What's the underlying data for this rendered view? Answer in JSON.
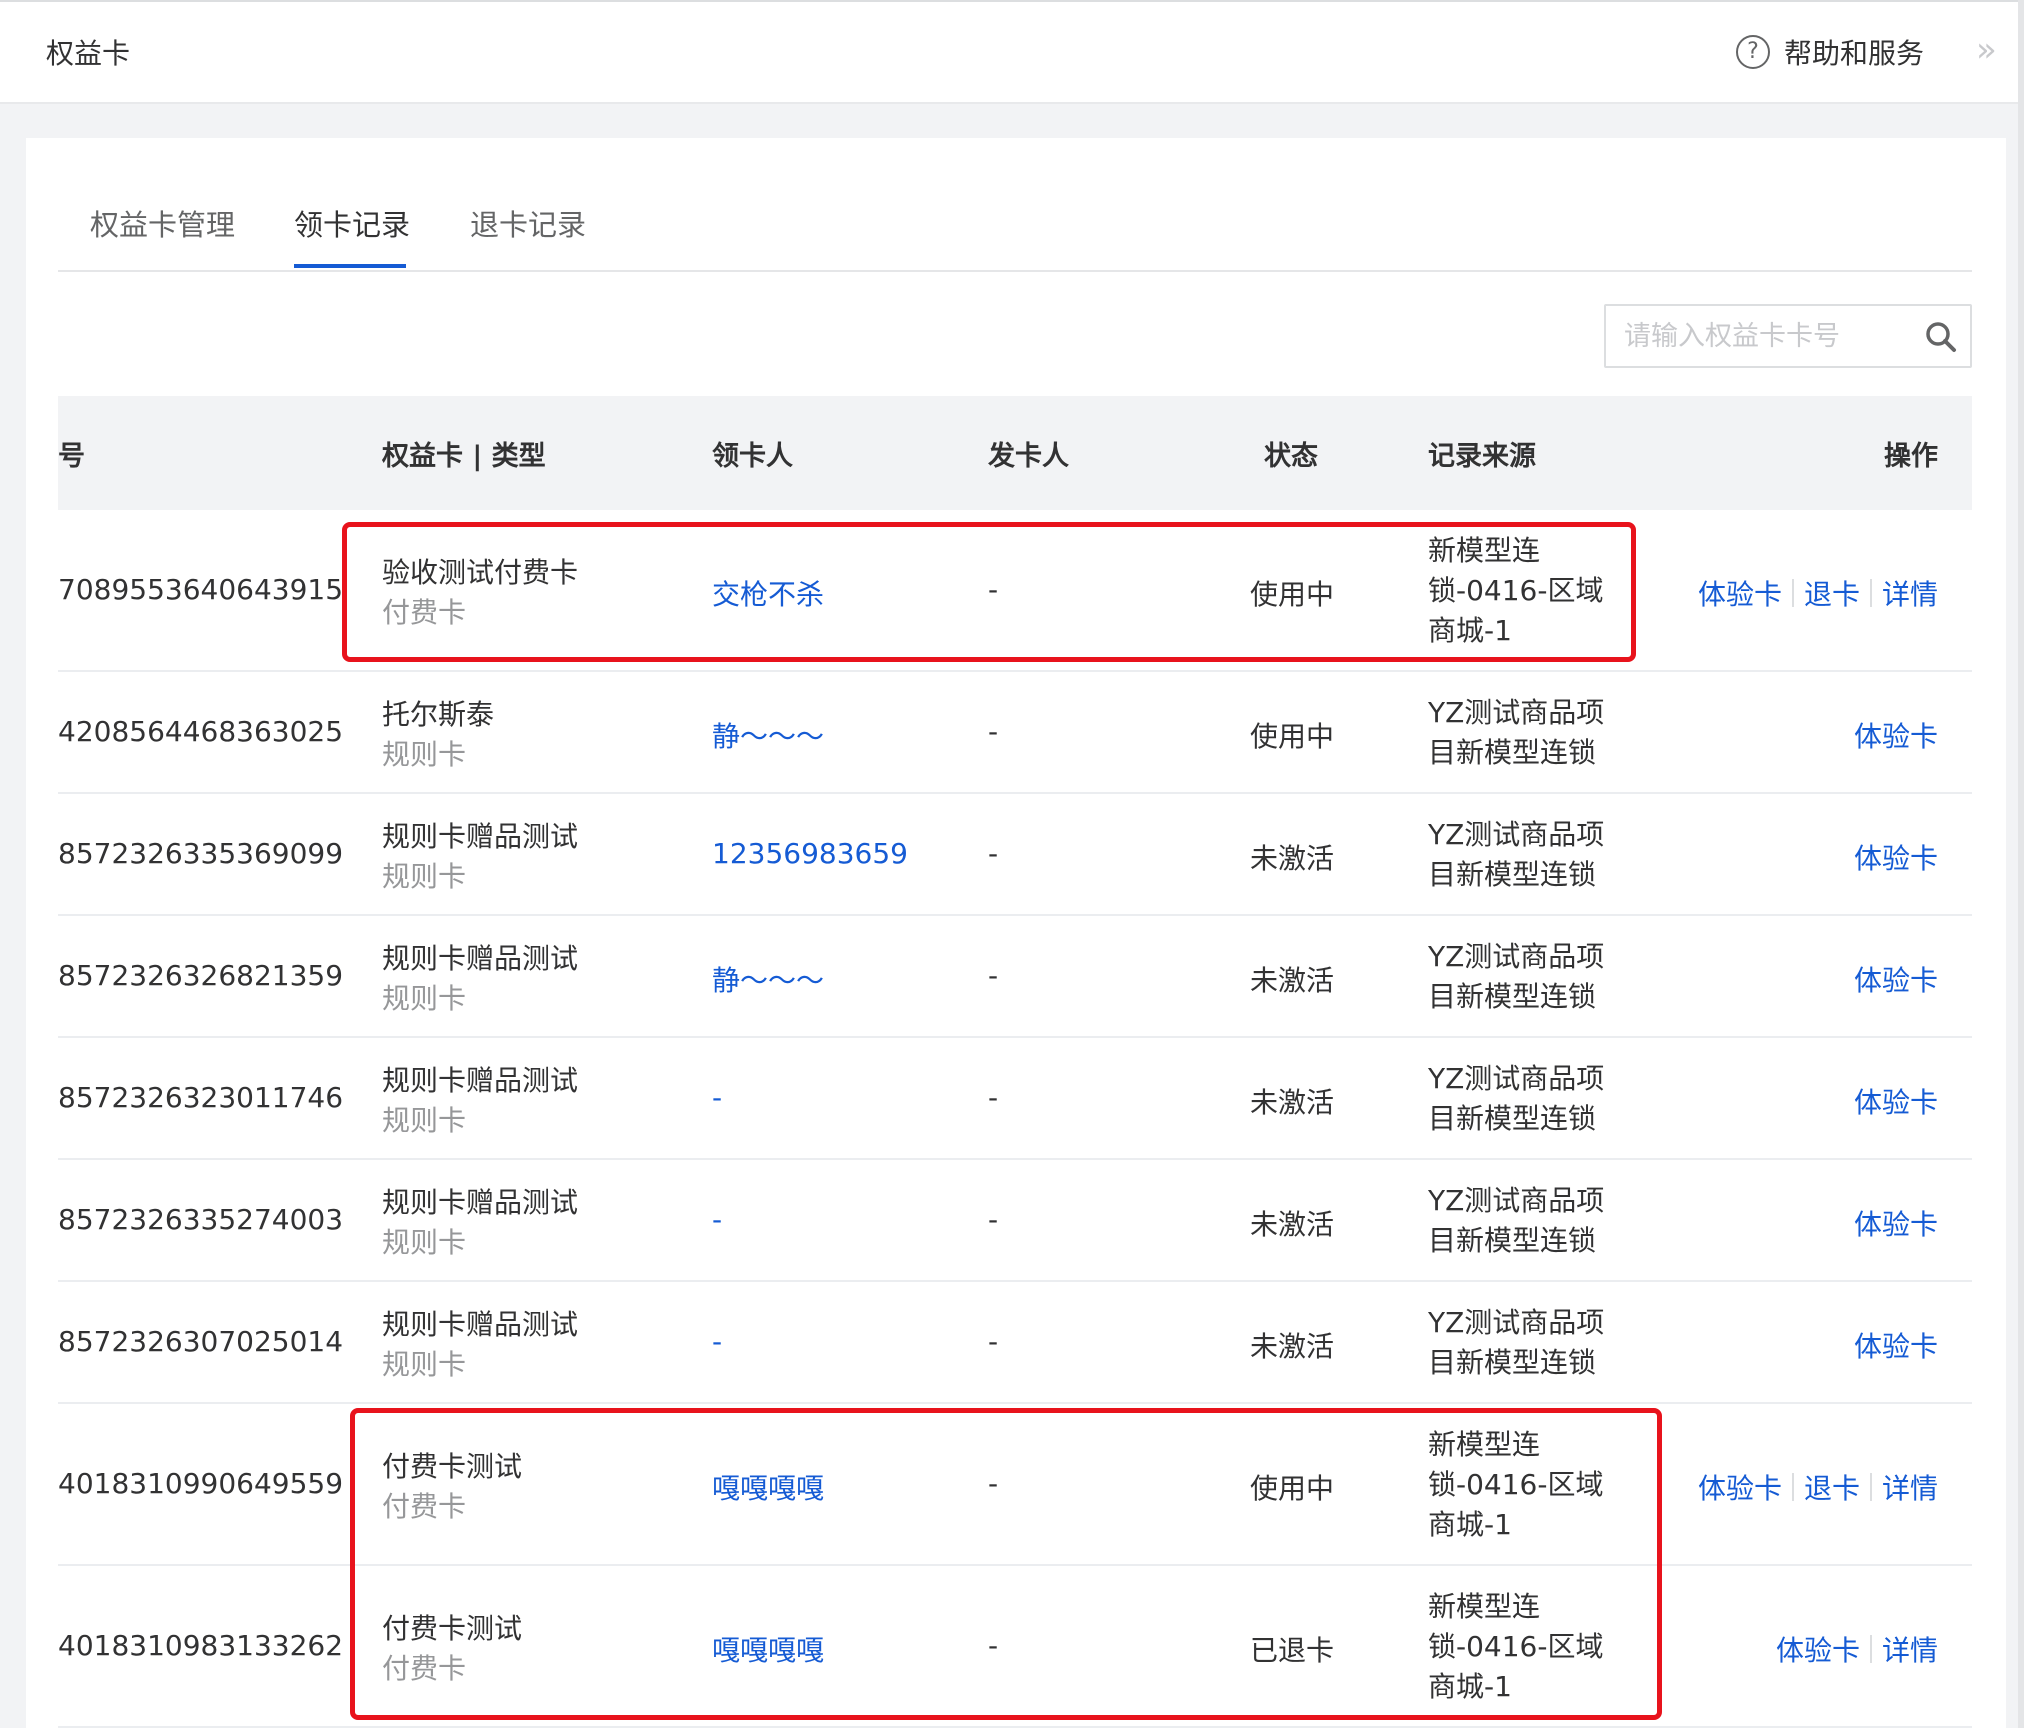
{
  "header": {
    "title": "权益卡",
    "help_label": "帮助和服务",
    "help_icon": "?",
    "collapse_icon": "»"
  },
  "tabs": [
    {
      "label": "权益卡管理",
      "active": false
    },
    {
      "label": "领卡记录",
      "active": true
    },
    {
      "label": "退卡记录",
      "active": false
    }
  ],
  "search": {
    "placeholder": "请输入权益卡卡号",
    "value": ""
  },
  "table": {
    "columns": [
      "号",
      "权益卡 | 类型",
      "领卡人",
      "发卡人",
      "状态",
      "记录来源",
      "操作"
    ],
    "rows": [
      {
        "card_no": "7089553640643915",
        "card_name": "验收测试付费卡",
        "card_type": "付费卡",
        "receiver": "交枪不杀",
        "issuer": "-",
        "status": "使用中",
        "source": [
          "新模型连",
          "锁-0416-区域",
          "商城-1"
        ],
        "actions": [
          "体验卡",
          "退卡",
          "详情"
        ]
      },
      {
        "card_no": "4208564468363025",
        "card_name": "托尔斯泰",
        "card_type": "规则卡",
        "receiver": "静～～～",
        "issuer": "-",
        "status": "使用中",
        "source": [
          "YZ测试商品项",
          "目新模型连锁"
        ],
        "actions": [
          "体验卡"
        ]
      },
      {
        "card_no": "8572326335369099",
        "card_name": "规则卡赠品测试",
        "card_type": "规则卡",
        "receiver": "12356983659",
        "issuer": "-",
        "status": "未激活",
        "source": [
          "YZ测试商品项",
          "目新模型连锁"
        ],
        "actions": [
          "体验卡"
        ]
      },
      {
        "card_no": "8572326326821359",
        "card_name": "规则卡赠品测试",
        "card_type": "规则卡",
        "receiver": "静～～～",
        "issuer": "-",
        "status": "未激活",
        "source": [
          "YZ测试商品项",
          "目新模型连锁"
        ],
        "actions": [
          "体验卡"
        ]
      },
      {
        "card_no": "8572326323011746",
        "card_name": "规则卡赠品测试",
        "card_type": "规则卡",
        "receiver": "-",
        "issuer": "-",
        "status": "未激活",
        "source": [
          "YZ测试商品项",
          "目新模型连锁"
        ],
        "actions": [
          "体验卡"
        ]
      },
      {
        "card_no": "8572326335274003",
        "card_name": "规则卡赠品测试",
        "card_type": "规则卡",
        "receiver": "-",
        "issuer": "-",
        "status": "未激活",
        "source": [
          "YZ测试商品项",
          "目新模型连锁"
        ],
        "actions": [
          "体验卡"
        ]
      },
      {
        "card_no": "8572326307025014",
        "card_name": "规则卡赠品测试",
        "card_type": "规则卡",
        "receiver": "-",
        "issuer": "-",
        "status": "未激活",
        "source": [
          "YZ测试商品项",
          "目新模型连锁"
        ],
        "actions": [
          "体验卡"
        ]
      },
      {
        "card_no": "4018310990649559",
        "card_name": "付费卡测试",
        "card_type": "付费卡",
        "receiver": "嘎嘎嘎嘎",
        "issuer": "-",
        "status": "使用中",
        "source": [
          "新模型连",
          "锁-0416-区域",
          "商城-1"
        ],
        "actions": [
          "体验卡",
          "退卡",
          "详情"
        ]
      },
      {
        "card_no": "4018310983133262",
        "card_name": "付费卡测试",
        "card_type": "付费卡",
        "receiver": "嘎嘎嘎嘎",
        "issuer": "-",
        "status": "已退卡",
        "source": [
          "新模型连",
          "锁-0416-区域",
          "商城-1"
        ],
        "actions": [
          "体验卡",
          "详情"
        ]
      }
    ]
  },
  "colors": {
    "link": "#155bd4",
    "highlight": "#e8131c",
    "muted": "#969799",
    "text": "#323233"
  }
}
